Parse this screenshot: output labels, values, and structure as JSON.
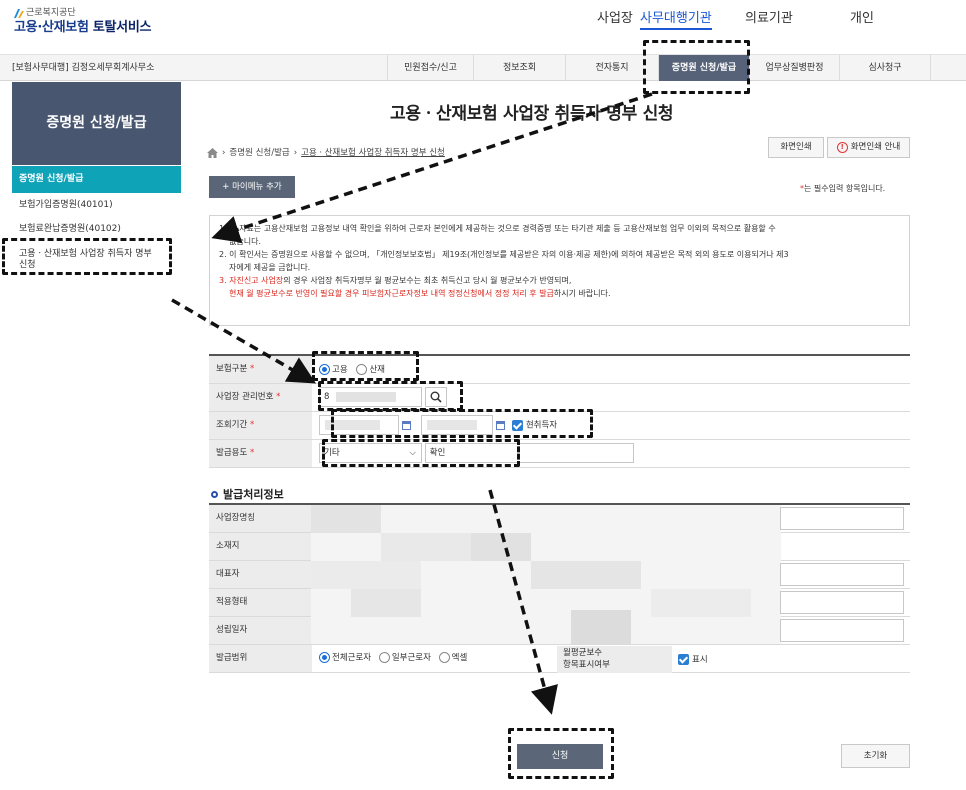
{
  "brand": {
    "agency": "근로복지공단",
    "service_a": "고용·산재보험",
    "service_b": "토탈서비스"
  },
  "top_nav": [
    "사업장",
    "사무대행기관",
    "의료기관",
    "개인"
  ],
  "gnb": {
    "office": "[보험사무대행] 김정오세무회계사무소",
    "items": [
      "민원접수/신고",
      "정보조회",
      "전자통지",
      "증명원 신청/발급",
      "업무상질병판정",
      "심사청구"
    ]
  },
  "sidebar": {
    "title": "증명원 신청/발급",
    "current": "증명원 신청/발급",
    "items": [
      "보험가입증명원(40101)",
      "보험료완납증명원(40102)",
      "고용ㆍ산재보험 사업장 취득자 명부",
      "신청"
    ]
  },
  "page": {
    "title": "고용ㆍ산재보험 사업장 취득자 명부 신청",
    "breadcrumb": [
      "증명원 신청/발급",
      "고용ㆍ산재보험 사업장 취득자 명부 신청"
    ],
    "print_label": "화면인쇄",
    "print_guide_label": "화면인쇄 안내",
    "mymenu_label": "+ 마이메뉴 추가",
    "required_mark": "*",
    "required_note": "는 필수입력 항목입니다."
  },
  "notice": {
    "line1": "1. 본 자료는 고용산재보험 고용정보 내역 확인을 위하여 근로자 본인에게 제공하는 것으로 경력증명 또는 타기관 제출 등 고용산재보험 업무 이외의 목적으로 활용할 수",
    "line1b": "없습니다.",
    "line2": "2. 이 확인서는 증명원으로 사용할 수 없으며, 「개인정보보호법」 제19조(개인정보를 제공받은 자의 이용·제공 제한)에 의하여 제공받은 목적 외의 용도로 이용되거나 제3",
    "line2b": "자에게 제공을 금합니다.",
    "line3_num": "3.",
    "line3_red": "자진신고 사업장",
    "line3_rest": "의 경우 사업장 취득자명부 월 평균보수는 최초 취득신고 당시 월 평균보수가 반영되며,",
    "line4_red": "현재 월 평균보수로 반영이 필요할 경우 피보험자근로자정보 내역 정정신청에서 정정 처리 후 발급",
    "line4_rest": "하시기 바랍니다."
  },
  "form": {
    "insurance_type": {
      "label": "보험구분",
      "options": [
        "고용",
        "산재"
      ],
      "selected": "고용"
    },
    "biz_no": {
      "label": "사업장 관리번호",
      "value": "8"
    },
    "period": {
      "label": "조회기간",
      "current_worker_label": "현취득자",
      "current_worker_checked": true
    },
    "purpose": {
      "label": "발급용도",
      "select_value": "기타",
      "text_value": "확인"
    }
  },
  "issue_info": {
    "title": "발급처리정보",
    "labels": [
      "사업장명칭",
      "소재지",
      "대표자",
      "적용형태",
      "성립일자",
      "발급범위"
    ],
    "scope_options": [
      "전체근로자",
      "일부근로자",
      "엑셀"
    ],
    "scope_selected": "전체근로자",
    "avg_pay_label_1": "월평균보수",
    "avg_pay_label_2": "항목표시여부",
    "avg_pay_display": "표시"
  },
  "actions": {
    "apply": "신청",
    "reset": "초기화"
  },
  "colors": {
    "accent_blue": "#1a58d6",
    "teal": "#0fa3b8",
    "slate": "#485670",
    "required_red": "#e53333"
  }
}
